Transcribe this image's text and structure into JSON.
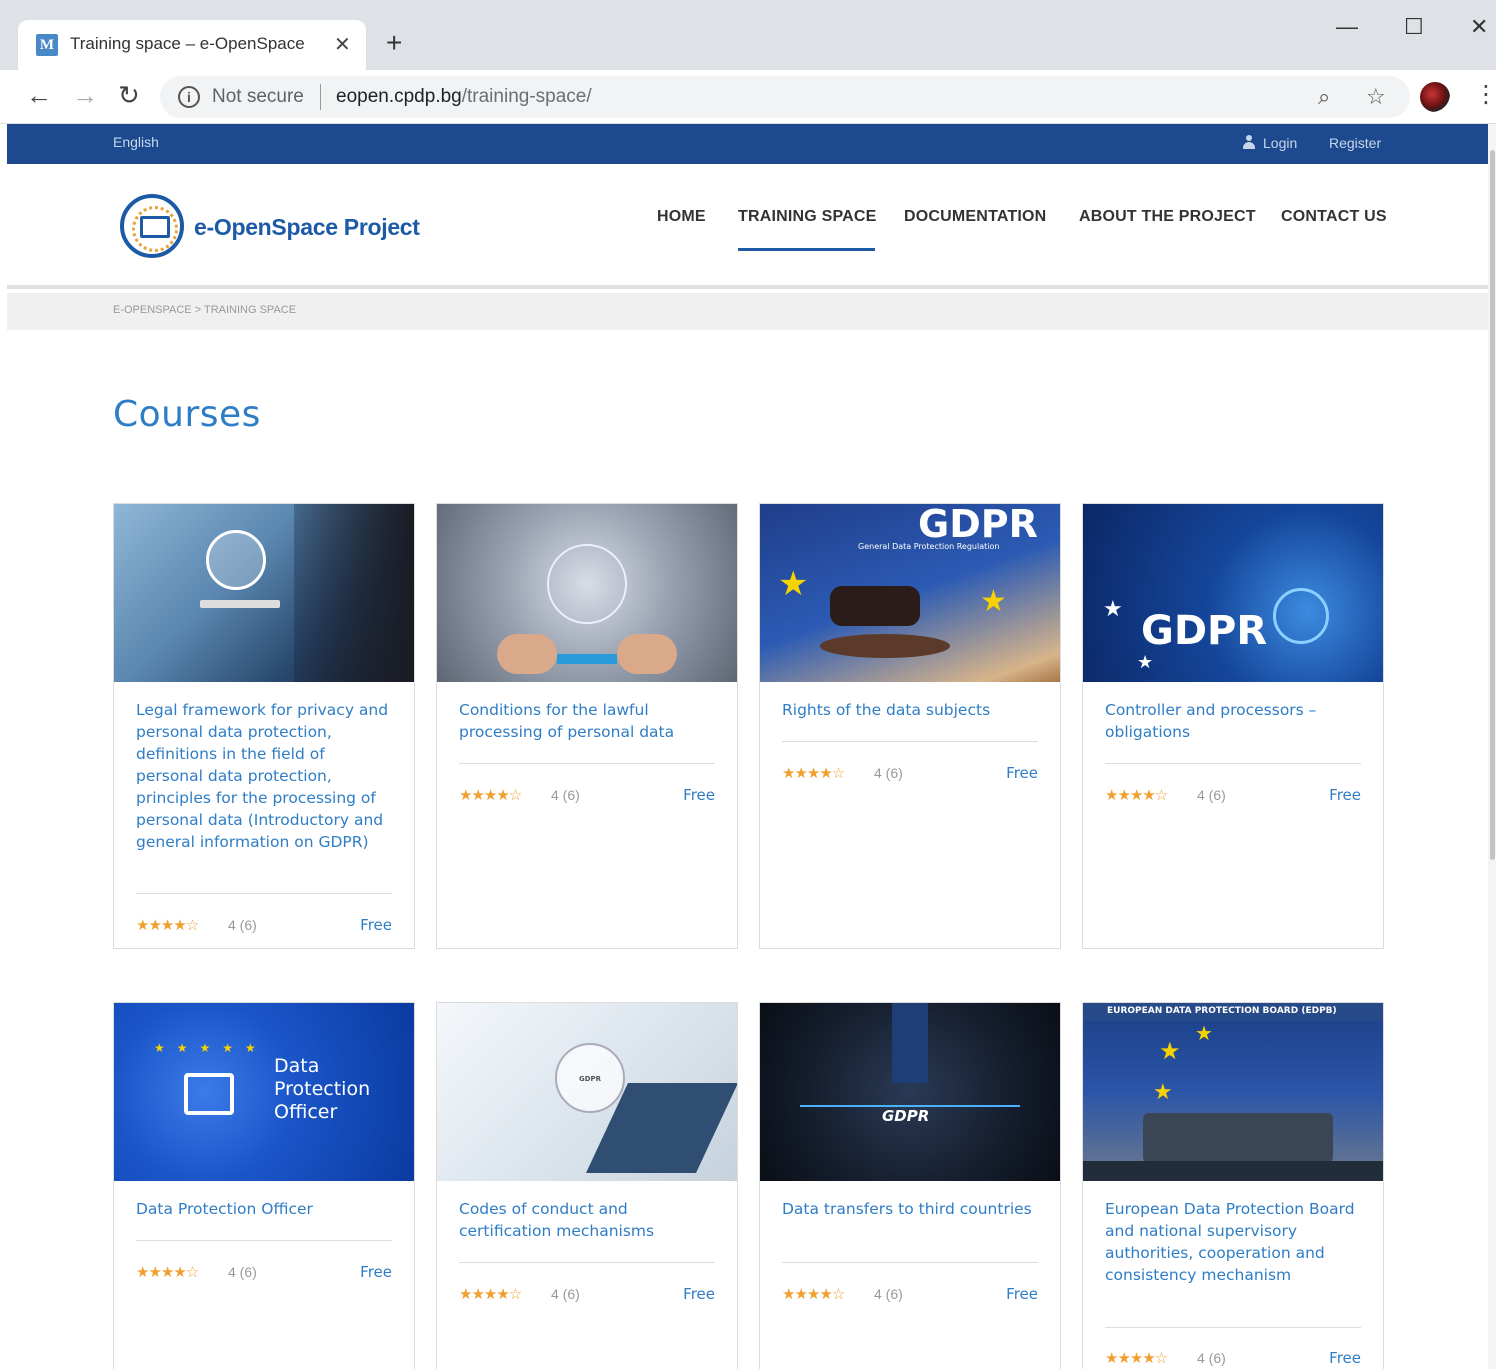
{
  "browser": {
    "tab_title": "Training space – e-OpenSpace",
    "favicon_letter": "M",
    "not_secure": "Not secure",
    "url_host": "eopen.cpdp.bg",
    "url_path": "/training-space/"
  },
  "topbar": {
    "language": "English",
    "login": "Login",
    "register": "Register"
  },
  "header": {
    "logo_text": "e-OpenSpace Project",
    "menu": [
      "HOME",
      "TRAINING SPACE",
      "DOCUMENTATION",
      "ABOUT THE PROJECT",
      "CONTACT US"
    ],
    "active_menu": "TRAINING SPACE"
  },
  "breadcrumb": "E-OPENSPACE > TRAINING SPACE",
  "page_title": "Courses",
  "courses": [
    {
      "title": "Legal framework for privacy and personal data protection, definitions in the field of personal data protection, principles for the processing of personal data (Introductory and general information on GDPR)",
      "stars": "★★★★☆",
      "rating": "4 (6)",
      "price": "Free",
      "image": "lock-tablet"
    },
    {
      "title": "Conditions for the lawful processing of personal data",
      "stars": "★★★★☆",
      "rating": "4 (6)",
      "price": "Free",
      "image": "circuit-hands"
    },
    {
      "title": "Rights of the data subjects",
      "stars": "★★★★☆",
      "rating": "4 (6)",
      "price": "Free",
      "image": "gdpr-gavel",
      "image_text": "GDPR",
      "image_subtext": "General Data Protection Regulation"
    },
    {
      "title": "Controller and processors – obligations",
      "stars": "★★★★☆",
      "rating": "4 (6)",
      "price": "Free",
      "image": "gdpr-shield",
      "image_text": "GDPR"
    },
    {
      "title": "Data Protection Officer",
      "stars": "★★★★☆",
      "rating": "4 (6)",
      "price": "Free",
      "image": "dpo-lock",
      "image_text": "Data Protection Officer"
    },
    {
      "title": "Codes of conduct and certification mechanisms",
      "stars": "★★★★☆",
      "rating": "4 (6)",
      "price": "Free",
      "image": "gdpr-finger",
      "image_text": "GDPR"
    },
    {
      "title": "Data transfers to third countries",
      "stars": "★★★★☆",
      "rating": "4 (6)",
      "price": "Free",
      "image": "gdpr-suit",
      "image_text": "GDPR"
    },
    {
      "title": "European Data Protection Board and national supervisory authorities, cooperation and consistency mechanism",
      "stars": "★★★★☆",
      "rating": "4 (6)",
      "price": "Free",
      "image": "edpb-laptop",
      "image_text": "EUROPEAN DATA PROTECTION BOARD (EDPB)"
    }
  ],
  "colors": {
    "brand_blue": "#1d4a8e",
    "link_blue": "#2e7dc6",
    "star": "#f0a030"
  }
}
